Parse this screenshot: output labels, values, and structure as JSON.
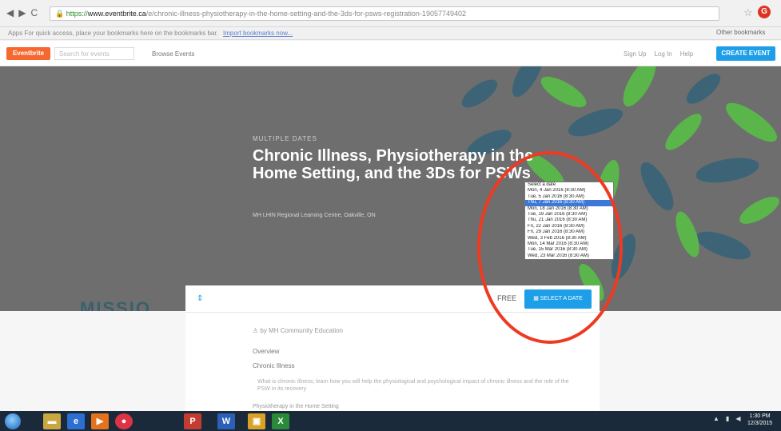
{
  "browser": {
    "url_scheme": "https://",
    "url_domain": "www.eventbrite.ca",
    "url_path": "/e/chronic-illness-physiotherapy-in-the-home-setting-and-the-3ds-for-psws-registration-19057749402",
    "bookmarks_apps": "Apps",
    "bookmarks_hint": "For quick access, place your bookmarks here on the bookmarks bar.",
    "bookmarks_import": "Import bookmarks now...",
    "other_bookmarks": "Other bookmarks"
  },
  "site_header": {
    "logo": "Eventbrite",
    "search_placeholder": "Search for events",
    "browse": "Browse Events",
    "sign_up": "Sign Up",
    "log_in": "Log In",
    "help": "Help",
    "create_event": "CREATE EVENT"
  },
  "hero": {
    "kicker": "MULTIPLE DATES",
    "title": "Chronic Illness, Physiotherapy in the Home Setting, and the 3Ds for PSWs",
    "venue": "MH LHIN Regional Learning Centre, Oakville, ON",
    "mission": "MISSIO"
  },
  "dropdown": {
    "placeholder": "Select a date",
    "selected_index": 2,
    "options": [
      "Mon, 4 Jan 2016 (8:30 AM)",
      "Tue, 5 Jan 2016 (8:30 AM)",
      "Thu, 7 Jan 2016 (8:30 AM)",
      "Mon, 18 Jan 2016 (8:30 AM)",
      "Tue, 19 Jan 2016 (8:30 AM)",
      "Thu, 21 Jan 2016 (8:30 AM)",
      "Fri, 22 Jan 2016 (8:30 AM)",
      "Fri, 29 Jan 2016 (8:30 AM)",
      "Wed, 3 Feb 2016 (8:30 AM)",
      "Mon, 14 Mar 2016 (8:30 AM)",
      "Tue, 15 Mar 2016 (8:30 AM)",
      "Wed, 23 Mar 2016 (8:30 AM)"
    ]
  },
  "ticket_bar": {
    "price": "FREE",
    "button": "SELECT A DATE"
  },
  "content": {
    "organizer": "by MH Community Education",
    "overview": "Overview",
    "course": "Chronic Illness",
    "bullet": "What is chronic illness; learn how you will help the physiological and psychological impact of chronic illness and the role of the PSW in its recovery",
    "subheading": "Physiotherapy in the Home Setting"
  },
  "taskbar": {
    "clock_time": "1:30 PM",
    "clock_date": "12/3/2015"
  },
  "colors": {
    "accent": "#1c9fe8",
    "brand": "#f6682f",
    "annotation": "#ef3a22",
    "leaf_teal": "#3d6476",
    "leaf_green": "#5ab54a"
  }
}
